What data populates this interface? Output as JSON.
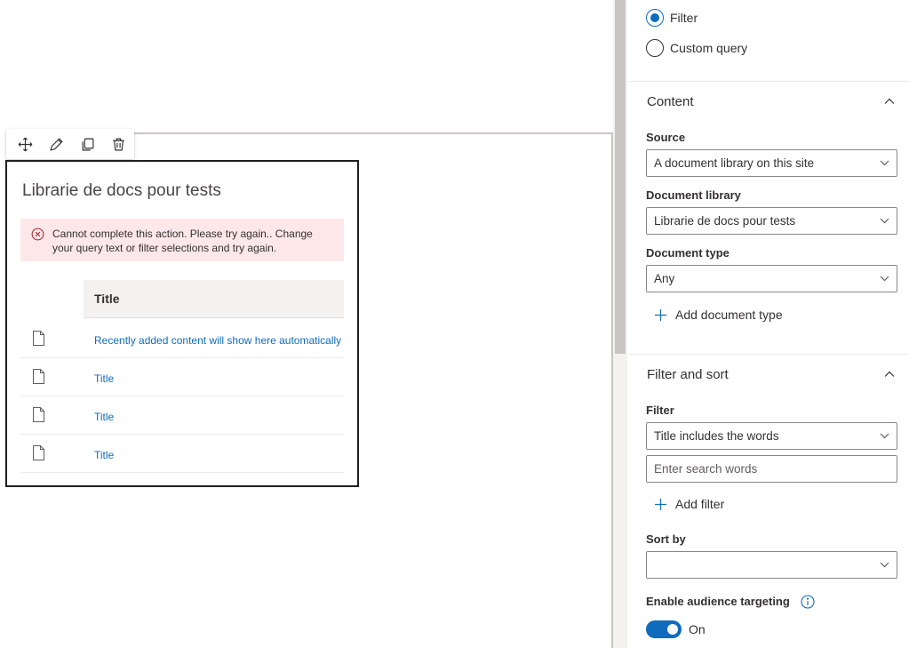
{
  "colors": {
    "accent": "#0f6cbd",
    "error_background": "#fde7e9",
    "error_icon": "#a4262c"
  },
  "toolbar": {
    "move_icon": "move-icon",
    "edit_icon": "edit-icon",
    "duplicate_icon": "duplicate-icon",
    "delete_icon": "delete-icon"
  },
  "webpart": {
    "title": "Librarie de docs pour tests",
    "error_message": "Cannot complete this action. Please try again.. Change your query text or filter selections and try again.",
    "column_header": "Title",
    "rows": [
      {
        "title": "Recently added content will show here automatically"
      },
      {
        "title": "Title"
      },
      {
        "title": "Title"
      },
      {
        "title": "Title"
      }
    ]
  },
  "pane": {
    "query_options": [
      {
        "label": "Filter",
        "selected": true
      },
      {
        "label": "Custom query",
        "selected": false
      }
    ],
    "content": {
      "title": "Content",
      "source_label": "Source",
      "source_value": "A document library on this site",
      "library_label": "Document library",
      "library_value": "Librarie de docs pour tests",
      "doctype_label": "Document type",
      "doctype_value": "Any",
      "add_doctype_label": "Add document type"
    },
    "filter_sort": {
      "title": "Filter and sort",
      "filter_label": "Filter",
      "filter_value": "Title includes the words",
      "search_placeholder": "Enter search words",
      "add_filter_label": "Add filter",
      "sort_label": "Sort by",
      "sort_value": "",
      "audience_label": "Enable audience targeting",
      "audience_state": "On"
    }
  }
}
